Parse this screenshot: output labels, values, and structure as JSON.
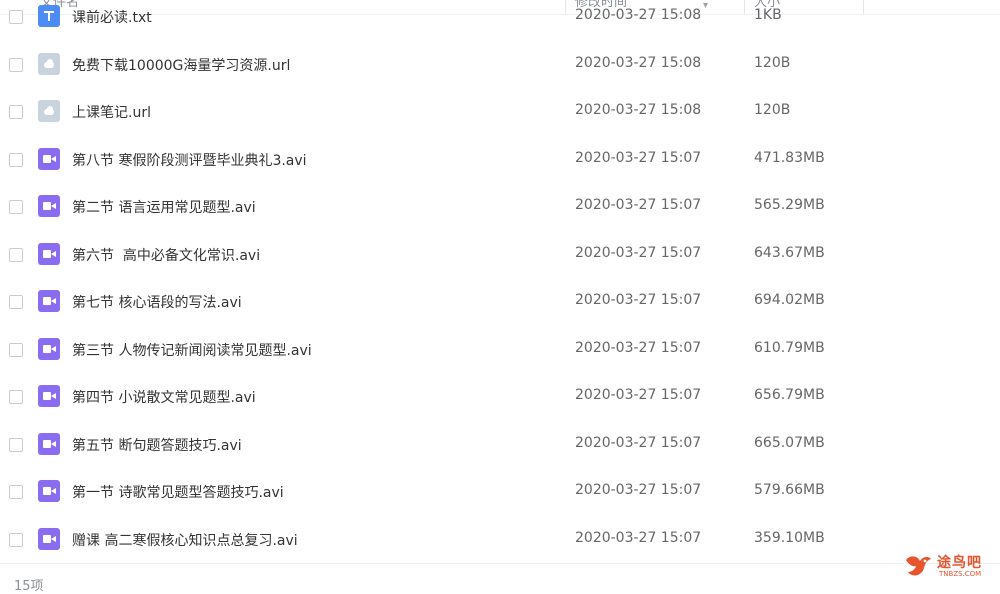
{
  "header": {
    "col_name": "文件名",
    "col_modified": "修改时间",
    "col_size": "大小"
  },
  "files": [
    {
      "name": "课前必读.txt",
      "modified": "2020-03-27 15:08",
      "size": "1KB",
      "type": "txt"
    },
    {
      "name": "免费下载10000G海量学习资源.url",
      "modified": "2020-03-27 15:08",
      "size": "120B",
      "type": "url"
    },
    {
      "name": "上课笔记.url",
      "modified": "2020-03-27 15:08",
      "size": "120B",
      "type": "url"
    },
    {
      "name": "第八节 寒假阶段测评暨毕业典礼3.avi",
      "modified": "2020-03-27 15:07",
      "size": "471.83MB",
      "type": "video"
    },
    {
      "name": "第二节 语言运用常见题型.avi",
      "modified": "2020-03-27 15:07",
      "size": "565.29MB",
      "type": "video"
    },
    {
      "name": "第六节  高中必备文化常识.avi",
      "modified": "2020-03-27 15:07",
      "size": "643.67MB",
      "type": "video"
    },
    {
      "name": "第七节 核心语段的写法.avi",
      "modified": "2020-03-27 15:07",
      "size": "694.02MB",
      "type": "video"
    },
    {
      "name": "第三节 人物传记新闻阅读常见题型.avi",
      "modified": "2020-03-27 15:07",
      "size": "610.79MB",
      "type": "video"
    },
    {
      "name": "第四节 小说散文常见题型.avi",
      "modified": "2020-03-27 15:07",
      "size": "656.79MB",
      "type": "video"
    },
    {
      "name": "第五节 断句题答题技巧.avi",
      "modified": "2020-03-27 15:07",
      "size": "665.07MB",
      "type": "video"
    },
    {
      "name": "第一节 诗歌常见题型答题技巧.avi",
      "modified": "2020-03-27 15:07",
      "size": "579.66MB",
      "type": "video"
    },
    {
      "name": "赠课 高二寒假核心知识点总复习.avi",
      "modified": "2020-03-27 15:07",
      "size": "359.10MB",
      "type": "video"
    }
  ],
  "footer": {
    "count": "15项"
  },
  "watermark": {
    "name": "途鸟吧",
    "domain": "TNBZS.COM"
  },
  "colors": {
    "video_icon": "#8a6cf0",
    "url_icon": "#c9d3de",
    "txt_icon": "#4d8cf5",
    "watermark": "#e8542d"
  }
}
